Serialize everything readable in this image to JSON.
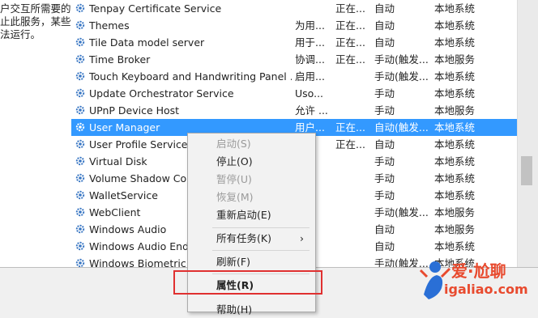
{
  "left_description": [
    "户交互所需要的",
    "止此服务，某些",
    "法运行。"
  ],
  "services": [
    {
      "name": "Tenpay Certificate Service",
      "desc": "",
      "status": "正在...",
      "startup": "自动",
      "logon": "本地系统"
    },
    {
      "name": "Themes",
      "desc": "为用...",
      "status": "正在...",
      "startup": "自动",
      "logon": "本地系统"
    },
    {
      "name": "Tile Data model server",
      "desc": "用于...",
      "status": "正在...",
      "startup": "自动",
      "logon": "本地系统"
    },
    {
      "name": "Time Broker",
      "desc": "协调...",
      "status": "正在...",
      "startup": "手动(触发...",
      "logon": "本地服务"
    },
    {
      "name": "Touch Keyboard and Handwriting Panel ...",
      "desc": "启用...",
      "status": "",
      "startup": "手动(触发...",
      "logon": "本地系统"
    },
    {
      "name": "Update Orchestrator Service",
      "desc": "Uso...",
      "status": "",
      "startup": "手动",
      "logon": "本地系统"
    },
    {
      "name": "UPnP Device Host",
      "desc": "允许 ...",
      "status": "",
      "startup": "手动",
      "logon": "本地服务"
    },
    {
      "name": "User Manager",
      "desc": "用户...",
      "status": "正在...",
      "startup": "自动(触发...",
      "logon": "本地系统",
      "selected": true
    },
    {
      "name": "User Profile Service",
      "desc": "",
      "status": "正在...",
      "startup": "自动",
      "logon": "本地系统"
    },
    {
      "name": "Virtual Disk",
      "desc": "",
      "status": "",
      "startup": "手动",
      "logon": "本地系统"
    },
    {
      "name": "Volume Shadow Cop",
      "desc": "",
      "status": "",
      "startup": "手动",
      "logon": "本地系统"
    },
    {
      "name": "WalletService",
      "desc": "",
      "status": "",
      "startup": "手动",
      "logon": "本地系统"
    },
    {
      "name": "WebClient",
      "desc": "",
      "status": "",
      "startup": "手动(触发...",
      "logon": "本地服务"
    },
    {
      "name": "Windows Audio",
      "desc": "",
      "status": "",
      "startup": "自动",
      "logon": "本地服务"
    },
    {
      "name": "Windows Audio Endp",
      "desc": "",
      "status": "",
      "startup": "自动",
      "logon": "本地系统"
    },
    {
      "name": "Windows Biometric S",
      "desc": "",
      "status": "",
      "startup": "手动(触发...",
      "logon": "本地系统"
    }
  ],
  "context_menu": {
    "start": "启动(S)",
    "stop": "停止(O)",
    "pause": "暂停(U)",
    "resume": "恢复(M)",
    "restart": "重新启动(E)",
    "all_tasks": "所有任务(K)",
    "all_tasks_arrow": "›",
    "refresh": "刷新(F)",
    "properties": "属性(R)",
    "help": "帮助(H)"
  },
  "bottom_tabs": {
    "extended": "",
    "standard": ""
  },
  "watermark": {
    "brand": "爱·尬聊",
    "url": "igaliao.com"
  },
  "colors": {
    "selection": "#3399ff",
    "highlight_box": "#e03030",
    "watermark": "#e84a2e"
  }
}
